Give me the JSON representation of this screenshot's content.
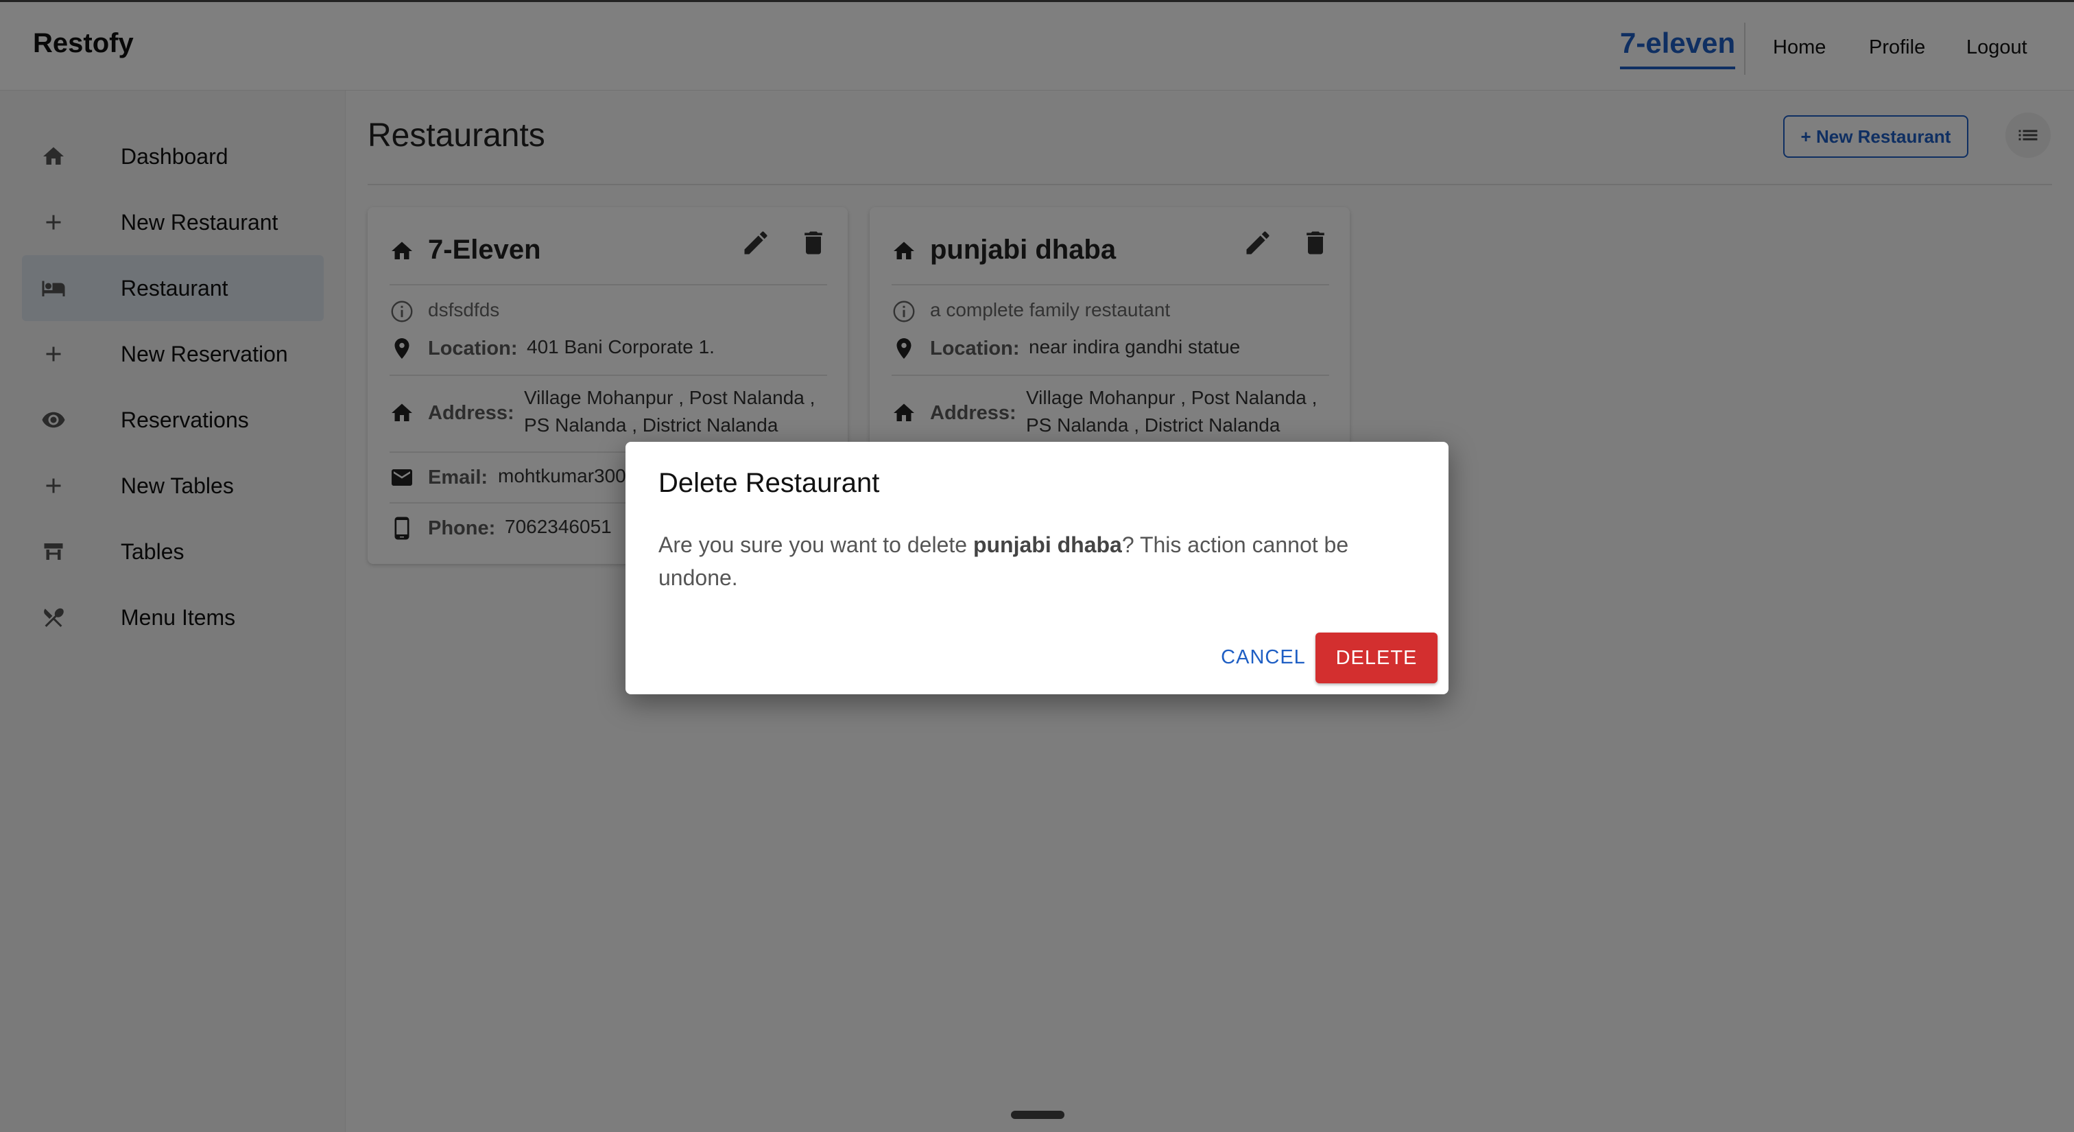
{
  "app": {
    "brand": "Restofy"
  },
  "topnav": {
    "active": "7-eleven",
    "links": [
      "Home",
      "Profile",
      "Logout"
    ]
  },
  "sidebar": {
    "items": [
      {
        "label": "Dashboard",
        "icon": "home-icon"
      },
      {
        "label": "New Restaurant",
        "icon": "plus-icon"
      },
      {
        "label": "Restaurant",
        "icon": "bed-icon",
        "active": true
      },
      {
        "label": "New Reservation",
        "icon": "plus-icon"
      },
      {
        "label": "Reservations",
        "icon": "eye-icon"
      },
      {
        "label": "New Tables",
        "icon": "plus-icon"
      },
      {
        "label": "Tables",
        "icon": "table-icon"
      },
      {
        "label": "Menu Items",
        "icon": "utensils-icon"
      }
    ]
  },
  "main": {
    "title": "Restaurants",
    "new_button": "+ New Restaurant",
    "cards": [
      {
        "name": "7-Eleven",
        "description": "dsfsdfds",
        "location_label": "Location:",
        "location": "401 Bani Corporate 1.",
        "address_label": "Address:",
        "address_line1": "Village Mohanpur , Post Nalanda ,",
        "address_line2": "PS Nalanda , District Nalanda",
        "email_label": "Email:",
        "email": "mohtkumar300",
        "phone_label": "Phone:",
        "phone": "7062346051"
      },
      {
        "name": "punjabi dhaba",
        "description": "a complete family restautant",
        "location_label": "Location:",
        "location": "near indira gandhi statue",
        "address_label": "Address:",
        "address_line1": "Village Mohanpur , Post Nalanda ,",
        "address_line2": "PS Nalanda , District Nalanda"
      }
    ]
  },
  "dialog": {
    "title": "Delete Restaurant",
    "message_prefix": "Are you sure you want to delete ",
    "target": "punjabi dhaba",
    "message_suffix": "? This action cannot be undone.",
    "cancel_label": "CANCEL",
    "delete_label": "DELETE"
  },
  "colors": {
    "accent": "#1f5fc4",
    "danger": "#d32f2f"
  }
}
